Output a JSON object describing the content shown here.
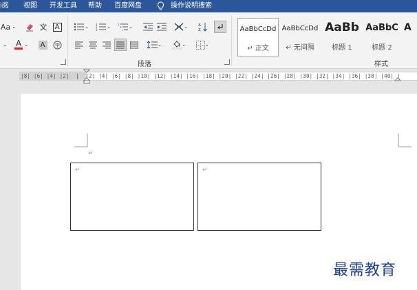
{
  "menubar": {
    "items": [
      "i阅",
      "视图",
      "开发工具",
      "帮助",
      "百度网盘"
    ],
    "search_label": "操作说明搜索"
  },
  "ribbon": {
    "font_size_button": "Aa",
    "font_color_letter": "A",
    "shading_letter": "A",
    "highlight_letter": "A",
    "clear_format_glyph": "文",
    "groups": {
      "paragraph": "段落",
      "styles": "样式"
    },
    "styles": [
      {
        "sample": "AaBbCcDd",
        "name": "↵ 正文"
      },
      {
        "sample": "AaBbCcDd",
        "name": "↵ 无间隔"
      },
      {
        "sample": "AaBb",
        "name": "标题 1"
      },
      {
        "sample": "AaBbC",
        "name": "标题 2"
      },
      {
        "sample": "A",
        "name": ""
      }
    ]
  },
  "ruler": {
    "text": "|8| |6| |4| |2|  |  |2| |4| |6| |8| |10| |12| |14| |16| |18| |20| |22| |24| |26| |28| |30| |32| |34| |36| |38| |40| |"
  },
  "document": {
    "paragraph_mark": "↵"
  },
  "watermark": "最需教育",
  "colors": {
    "title_bar": "#2b579a",
    "ribbon_bg": "#f3f3f3",
    "font_color_red": "#e02020",
    "watermark": "#1e3f9a"
  }
}
